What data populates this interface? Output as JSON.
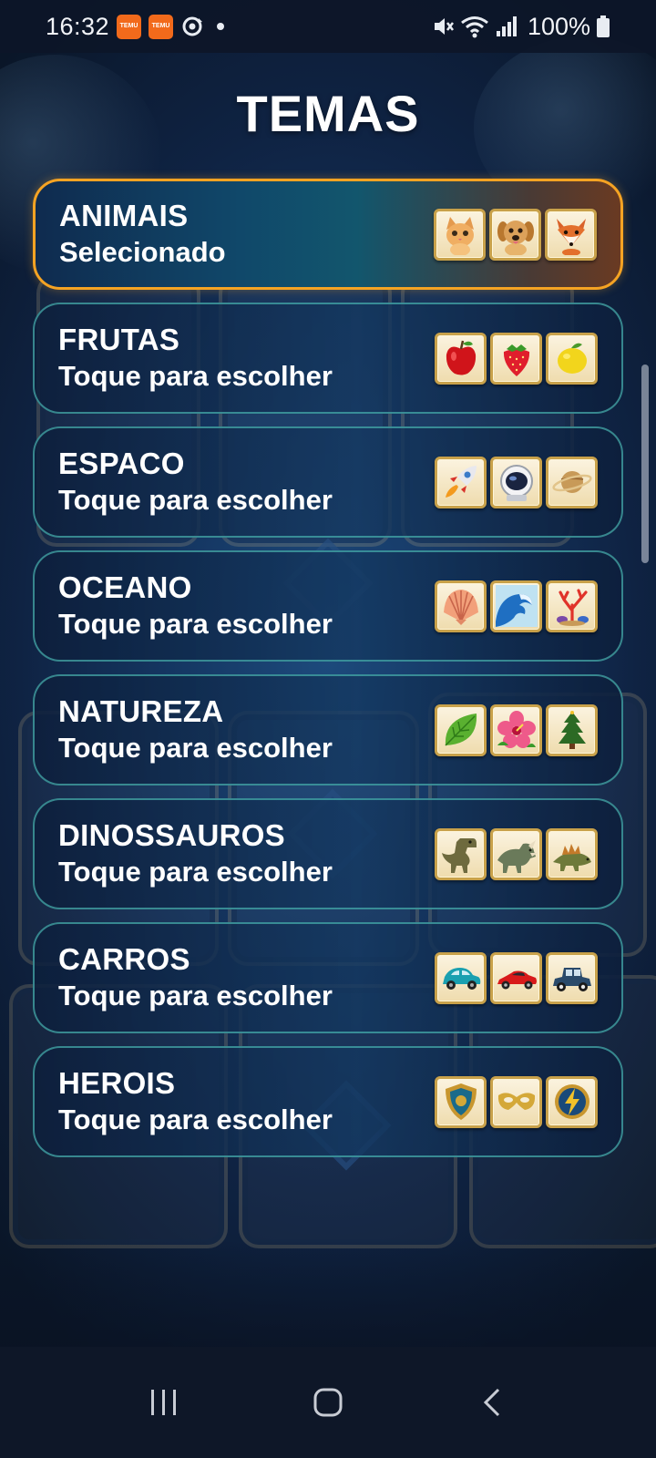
{
  "status_bar": {
    "time": "16:32",
    "app_badges": [
      "TEMU",
      "TEMU"
    ],
    "battery": "100%",
    "icons": [
      "temu-app-icon",
      "temu-app-icon",
      "sync-icon",
      "notification-dot-icon",
      "mute-icon",
      "wifi-icon",
      "signal-icon",
      "battery-icon"
    ]
  },
  "title": "TEMAS",
  "themes": [
    {
      "name": "ANIMAIS",
      "status": "Selecionado",
      "selected": true,
      "tiles": [
        "kitten",
        "puppy",
        "fox"
      ]
    },
    {
      "name": "FRUTAS",
      "status": "Toque para escolher",
      "selected": false,
      "tiles": [
        "apple",
        "strawberry",
        "lemon"
      ]
    },
    {
      "name": "ESPACO",
      "status": "Toque para escolher",
      "selected": false,
      "tiles": [
        "rocket",
        "astronaut-helmet",
        "planet"
      ]
    },
    {
      "name": "OCEANO",
      "status": "Toque para escolher",
      "selected": false,
      "tiles": [
        "seashell",
        "wave",
        "coral"
      ]
    },
    {
      "name": "NATUREZA",
      "status": "Toque para escolher",
      "selected": false,
      "tiles": [
        "leaf",
        "flower",
        "pine-tree"
      ]
    },
    {
      "name": "DINOSSAUROS",
      "status": "Toque para escolher",
      "selected": false,
      "tiles": [
        "t-rex",
        "triceratops",
        "stegosaurus"
      ]
    },
    {
      "name": "CARROS",
      "status": "Toque para escolher",
      "selected": false,
      "tiles": [
        "small-car",
        "sports-car",
        "vintage-car"
      ]
    },
    {
      "name": "HEROIS",
      "status": "Toque para escolher",
      "selected": false,
      "tiles": [
        "shield",
        "mask",
        "lightning-emblem"
      ]
    }
  ],
  "nav": {
    "buttons": [
      "recents-icon",
      "home-icon",
      "back-icon"
    ]
  },
  "colors": {
    "selected_border": "#f5a323",
    "card_border": "#46aaaa",
    "background": "#0d1a2e"
  }
}
